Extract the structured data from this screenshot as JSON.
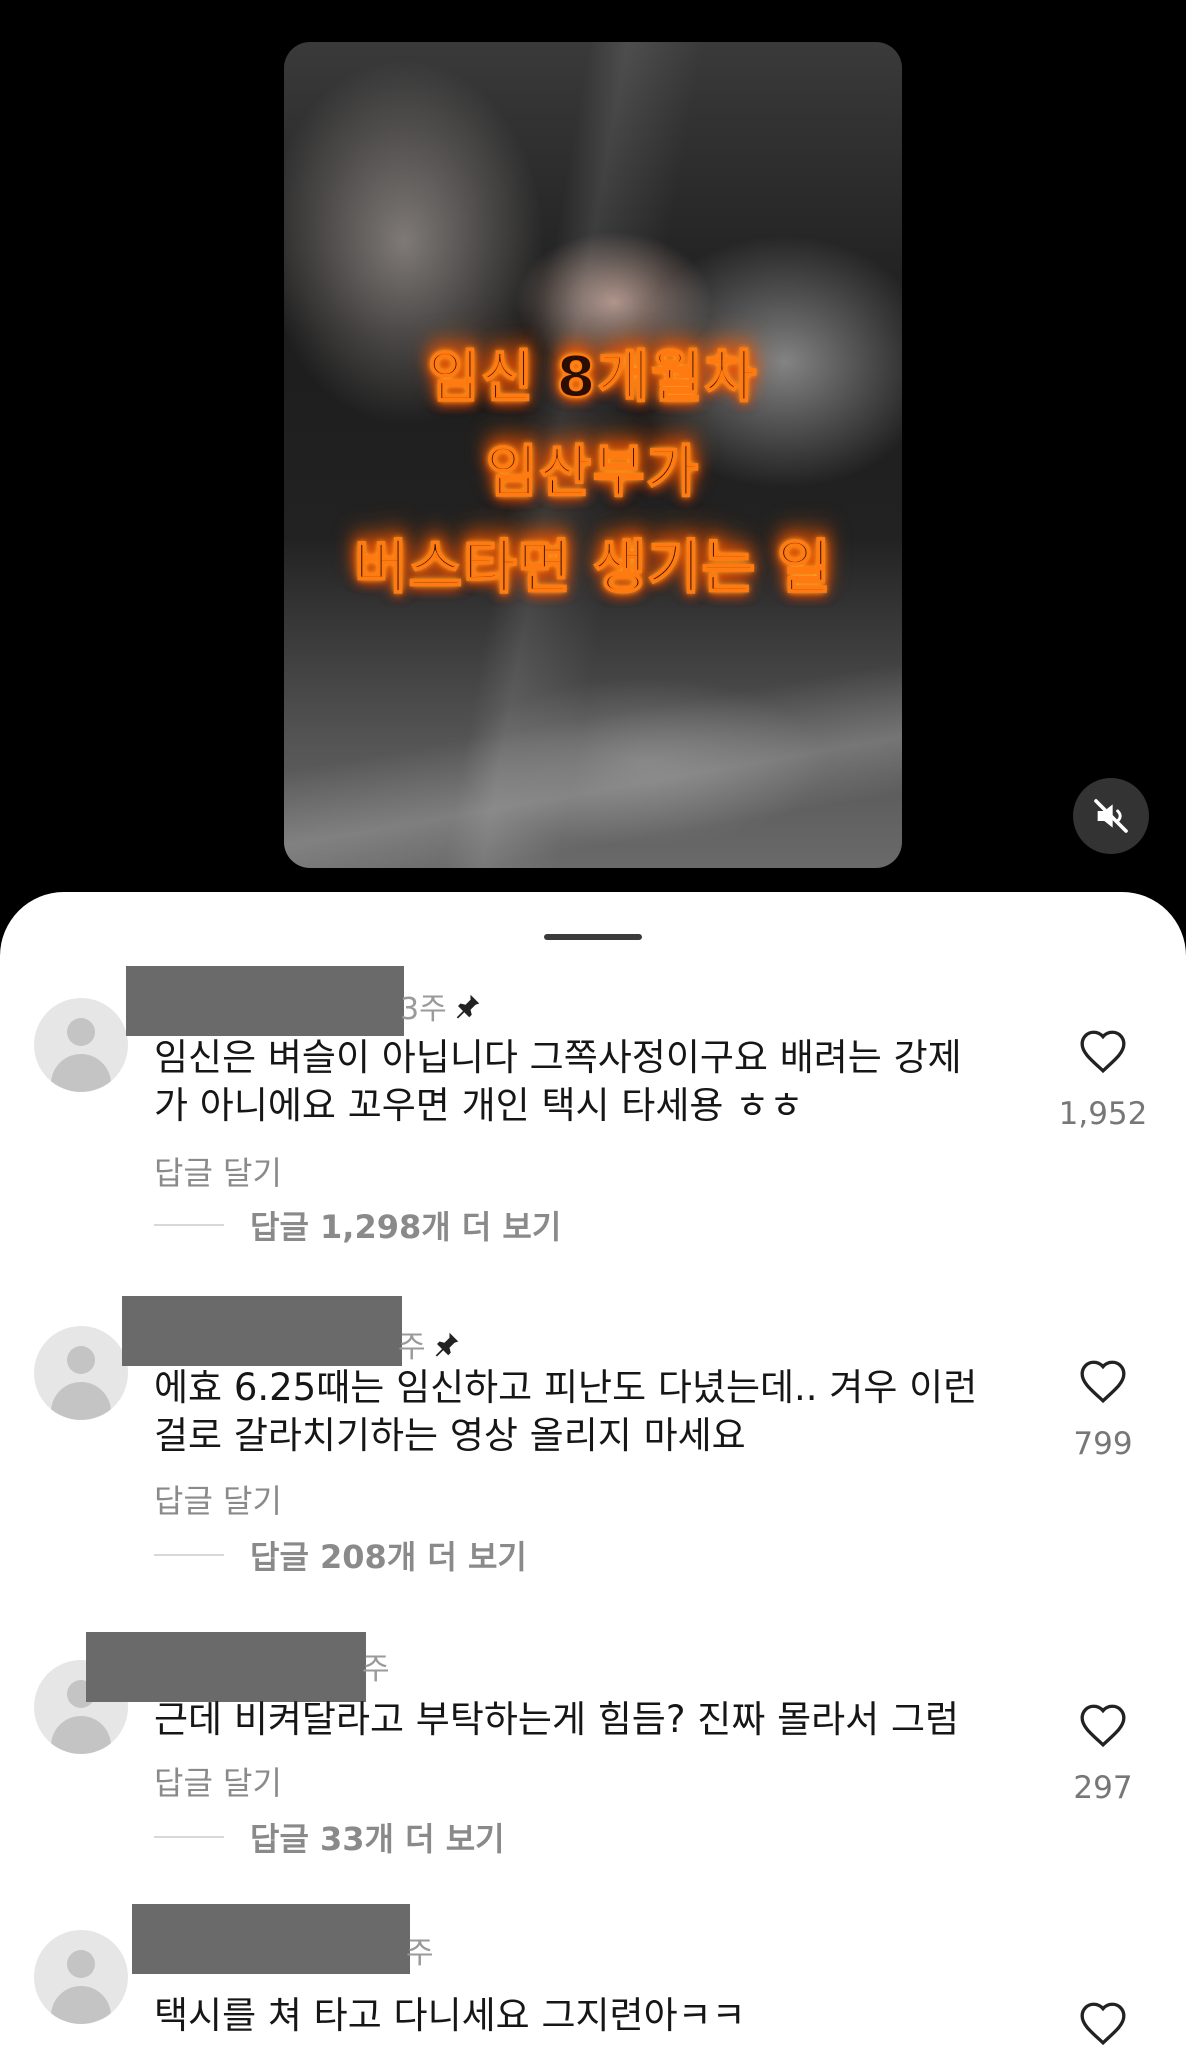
{
  "video": {
    "overlay_lines": [
      "임신 8개월차",
      "임산부가",
      "버스타면 생기는 일"
    ],
    "mute_icon": "muted-speaker-icon"
  },
  "comments": [
    {
      "time": "3주",
      "pinned": true,
      "text_lines": [
        "임신은 벼슬이 아닙니다 그쪽사정이구요 배려는 강제",
        "가 아니에요 꼬우면 개인 택시 타세용 ㅎㅎ"
      ],
      "reply_label": "답글 달기",
      "view_replies": "답글 1,298개 더 보기",
      "likes": "1,952"
    },
    {
      "time": "주",
      "pinned": true,
      "text_lines": [
        "에효 6.25때는 임신하고 피난도 다녔는데.. 겨우 이런",
        "걸로 갈라치기하는 영상 올리지 마세요"
      ],
      "reply_label": "답글 달기",
      "view_replies": "답글 208개 더 보기",
      "likes": "799"
    },
    {
      "time": "주",
      "pinned": false,
      "text_lines": [
        "근데 비켜달라고 부탁하는게 힘듬? 진짜 몰라서 그럼"
      ],
      "reply_label": "답글 달기",
      "view_replies": "답글 33개 더 보기",
      "likes": "297"
    },
    {
      "time": "주",
      "pinned": false,
      "text_lines": [
        "택시를 쳐 타고 다니세요 그지련아ㅋㅋ"
      ],
      "reply_label": "",
      "view_replies": "",
      "likes": ""
    }
  ],
  "colors": {
    "fire": "#ff6a00",
    "name_mask": "#6a6a6a",
    "muted_text": "#8a8a8a"
  }
}
